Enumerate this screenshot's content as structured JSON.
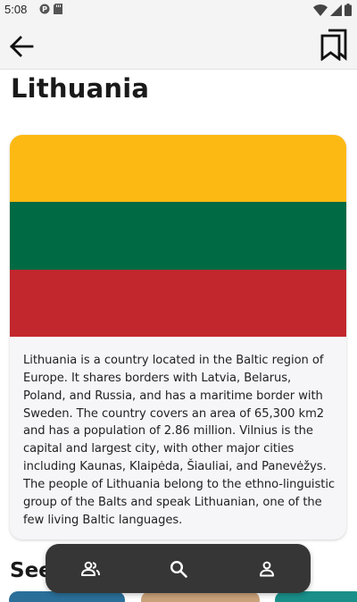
{
  "status_bar": {
    "time": "5:08"
  },
  "app_bar": {
    "back_icon": "arrow-left-icon",
    "bookmark_icon": "bookmarks-icon"
  },
  "country": {
    "name": "Lithuania",
    "flag_colors": [
      "#FDB913",
      "#006A44",
      "#C1272D"
    ],
    "description": "Lithuania is a country located in the Baltic region of Europe. It shares borders with Latvia, Belarus, Poland, and Russia, and has a maritime border with Sweden. The country covers an area of 65,300 km2 and has a population of 2.86 million. Vilnius is the capital and largest city, with other major cities including Kaunas, Klaipėda, Šiauliai, and Panevėžys. The people of Lithuania belong to the ethno-linguistic group of the Balts and speak Lithuanian, one of the few living Baltic languages."
  },
  "section": {
    "title": "See"
  },
  "bottom_nav": {
    "items": [
      {
        "icon": "people-icon"
      },
      {
        "icon": "search-icon"
      },
      {
        "icon": "person-icon"
      }
    ],
    "background": "#363636"
  }
}
